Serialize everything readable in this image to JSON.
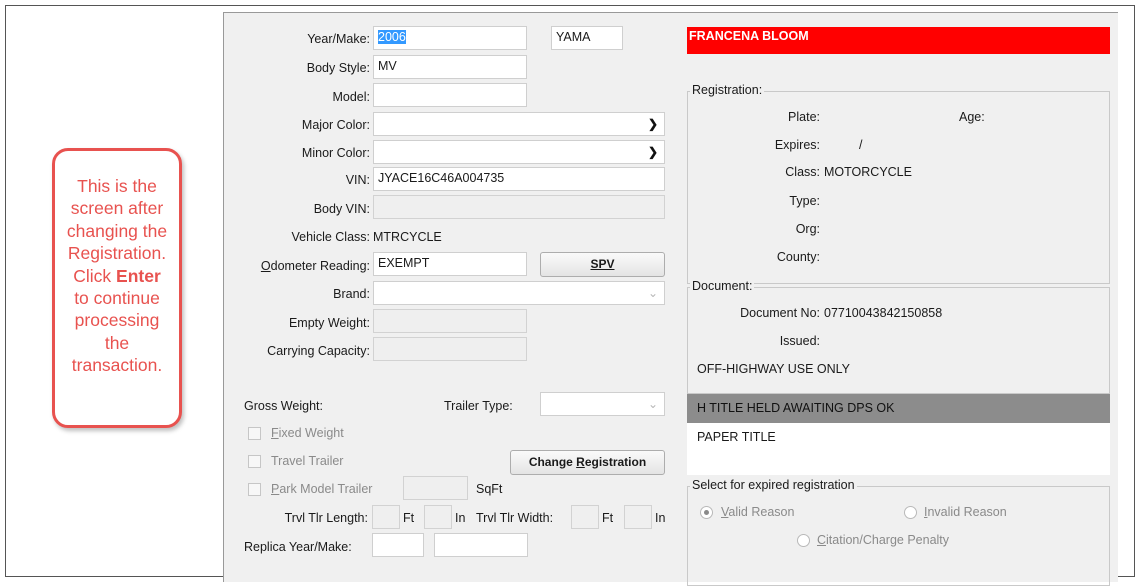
{
  "callout": {
    "line1": "This is the",
    "line2": "screen after",
    "line3": "changing the",
    "line4": "Registration.",
    "line5a": "Click ",
    "line5b": "Enter",
    "line6": "to continue",
    "line7": "processing",
    "line8": "the",
    "line9": "transaction."
  },
  "vehicle": {
    "year_make_label": "Year/Make:",
    "year": "2006",
    "make": "YAMA",
    "body_style_label": "Body Style:",
    "body_style": "MV",
    "model_label": "Model:",
    "model": "",
    "major_color_label": "Major Color:",
    "minor_color_label": "Minor Color:",
    "vin_label": "VIN:",
    "vin": "JYACE16C46A004735",
    "body_vin_label": "Body VIN:",
    "vehicle_class_label": "Vehicle Class:",
    "vehicle_class": "MTRCYCLE",
    "odometer_label_u": "O",
    "odometer_label_rest": "dometer Reading:",
    "odometer": "EXEMPT",
    "spv_label": "SPV",
    "brand_label": "Brand:",
    "empty_weight_label": "Empty Weight:",
    "carrying_capacity_label": "Carrying Capacity:",
    "gross_weight_label": "Gross Weight:",
    "trailer_type_label": "Trailer Type:",
    "fixed_weight_u": "F",
    "fixed_weight_rest": "ixed Weight",
    "travel_trailer_label": "Travel Trailer",
    "change_registration_pre": "Change ",
    "change_registration_u": "R",
    "change_registration_post": "egistration",
    "park_model_u": "P",
    "park_model_rest": "ark Model Trailer",
    "sqft_label": "SqFt",
    "trvl_length_label": "Trvl Tlr Length:",
    "ft_label": "Ft",
    "in_label": "In",
    "trvl_width_label": "Trvl Tlr Width:",
    "ft_label2": "Ft",
    "in_label2": "In",
    "replica_label": "Replica Year/Make:"
  },
  "owner": {
    "name": "FRANCENA BLOOM"
  },
  "registration": {
    "title": "Registration:",
    "plate_label": "Plate:",
    "age_label": "Age:",
    "expires_label": "Expires:",
    "expires_value": "/",
    "class_label": "Class:",
    "class_value": "MOTORCYCLE",
    "type_label": "Type:",
    "org_label": "Org:",
    "county_label": "County:"
  },
  "document": {
    "title": "Document:",
    "doc_no_label": "Document No:",
    "doc_no": "07710043842150858",
    "issued_label": "Issued:",
    "note": "OFF-HIGHWAY USE ONLY"
  },
  "title_status": {
    "held": "H  TITLE HELD AWAITING DPS OK",
    "paper": "PAPER TITLE"
  },
  "expired": {
    "title": "Select for expired registration",
    "valid_u": "V",
    "valid_rest": "alid Reason",
    "invalid_u": "I",
    "invalid_rest": "nvalid Reason",
    "citation_u": "C",
    "citation_rest": "itation/Charge Penalty",
    "selected": "Valid Reason"
  }
}
